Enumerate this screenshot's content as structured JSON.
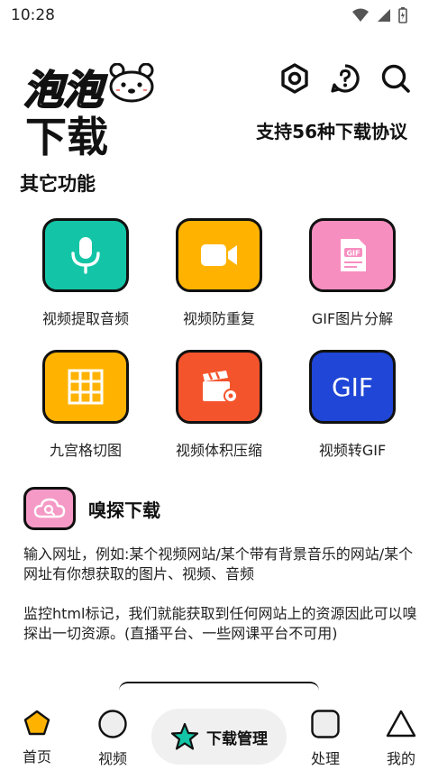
{
  "status_bar": {
    "time": "10:28"
  },
  "header": {
    "logo_title": "泡泡",
    "logo_sub": "下载",
    "tagline": "支持56种下载协议",
    "icons": [
      "settings-hex-icon",
      "help-icon",
      "search-icon"
    ]
  },
  "section": {
    "title": "其它功能"
  },
  "features": [
    {
      "label": "视频提取音频",
      "icon": "microphone-icon",
      "color": "#13c5a6"
    },
    {
      "label": "视频防重复",
      "icon": "video-camera-icon",
      "color": "#ffb300"
    },
    {
      "label": "GIF图片分解",
      "icon": "gif-file-icon",
      "color": "#f78ec0"
    },
    {
      "label": "九宫格切图",
      "icon": "grid-icon",
      "color": "#ffb300"
    },
    {
      "label": "视频体积压缩",
      "icon": "clapperboard-icon",
      "color": "#f4542c"
    },
    {
      "label": "视频转GIF",
      "icon": "gif-text-icon",
      "color": "#1f46d6",
      "icon_text": "GIF"
    }
  ],
  "sniff": {
    "title": "嗅探下载",
    "text1": "输入网址，例如:某个视频网站/某个带有背景音乐的网站/某个网址有你想获取的图片、视频、音频",
    "text2": "监控html标记，我们就能获取到任何网站上的资源因此可以嗅探出一切资源。(直播平台、一些网课平台不可用)"
  },
  "bottom_nav": {
    "items": [
      {
        "label": "首页",
        "icon": "pentagon-icon"
      },
      {
        "label": "视频",
        "icon": "circle-icon"
      },
      {
        "label": "处理",
        "icon": "square-icon"
      },
      {
        "label": "我的",
        "icon": "triangle-icon"
      }
    ],
    "center_label": "下载管理"
  },
  "colors": {
    "pentagon": "#ffb300",
    "star": "#13c5a6"
  }
}
